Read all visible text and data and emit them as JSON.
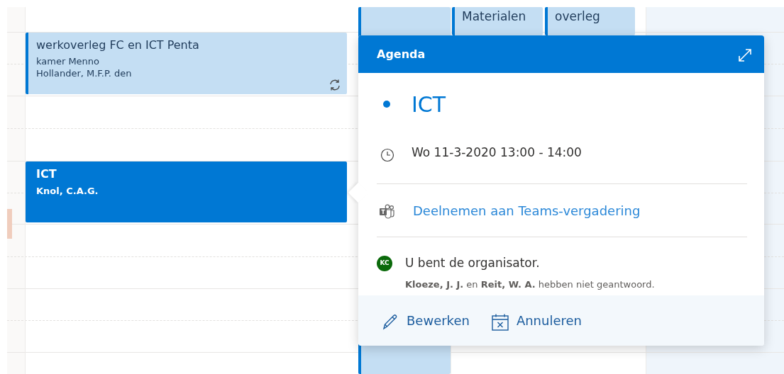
{
  "calendar": {
    "events": [
      {
        "title": "werkoverleg FC en ICT Penta",
        "location": "kamer Menno",
        "organizer": "Hollander, M.F.P. den",
        "recurring": true,
        "selected": false
      },
      {
        "title": "ICT",
        "organizer": "Knol, C.A.G.",
        "recurring": false,
        "selected": true
      }
    ],
    "other_events": [
      {
        "title": "Materialen"
      },
      {
        "title": "overleg"
      }
    ]
  },
  "popover": {
    "header": "Agenda",
    "title": "ICT",
    "color": "#0078d4",
    "datetime": "Wo 11-3-2020 13:00 - 14:00",
    "teams_link": "Deelnemen aan Teams-vergadering",
    "organizer": {
      "initials": "KC",
      "status": "U bent de organisator.",
      "responses": "**Kloeze, J. J.** en **Reit, W. A.** hebben niet geantwoord."
    },
    "actions": [
      {
        "kind": "edit",
        "label": "Bewerken"
      },
      {
        "kind": "cancel",
        "label": "Annuleren"
      }
    ]
  }
}
